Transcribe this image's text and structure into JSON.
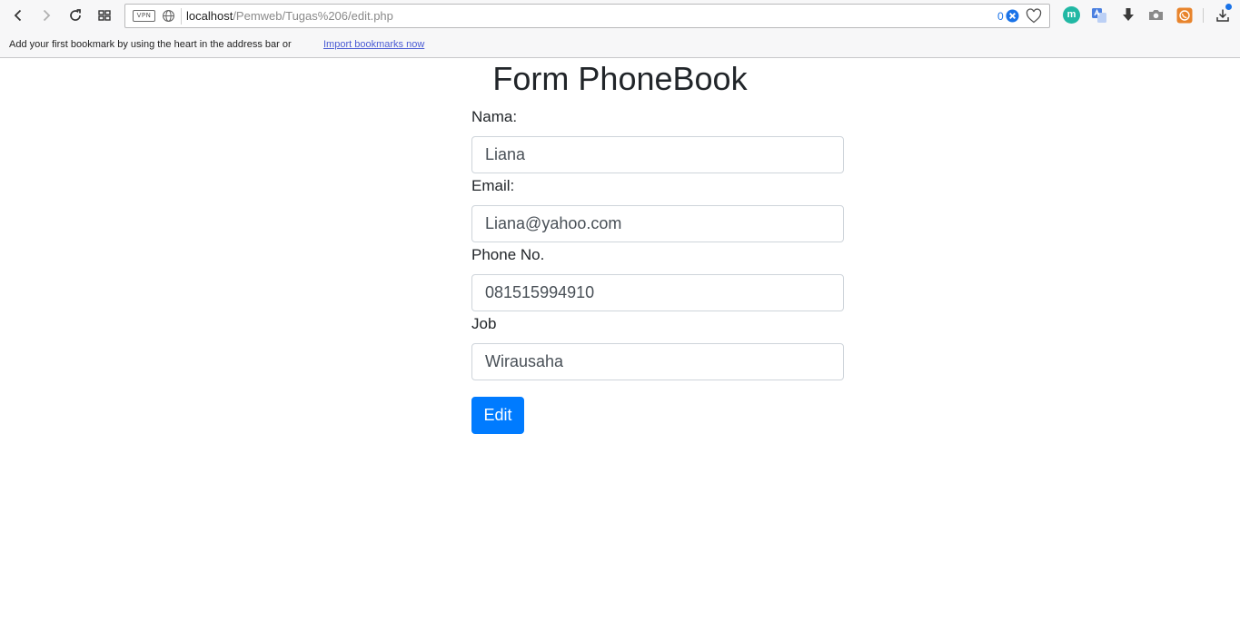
{
  "browser": {
    "url_host": "localhost",
    "url_path": "/Pemweb/Tugas%206/edit.php",
    "vpn_label": "VPN",
    "tracker_count": "0",
    "bookmarks_bar": {
      "message": "Add your first bookmark by using the heart in the address bar or",
      "import_link": "Import bookmarks now"
    },
    "extension_m_label": "m",
    "accent_color": "#1a73e8"
  },
  "form": {
    "title": "Form PhoneBook",
    "fields": [
      {
        "label": "Nama:",
        "value": "Liana"
      },
      {
        "label": "Email:",
        "value": "Liana@yahoo.com"
      },
      {
        "label": "Phone No.",
        "value": "081515994910"
      },
      {
        "label": "Job",
        "value": "Wirausaha"
      }
    ],
    "submit_label": "Edit",
    "button_color": "#007bff"
  }
}
